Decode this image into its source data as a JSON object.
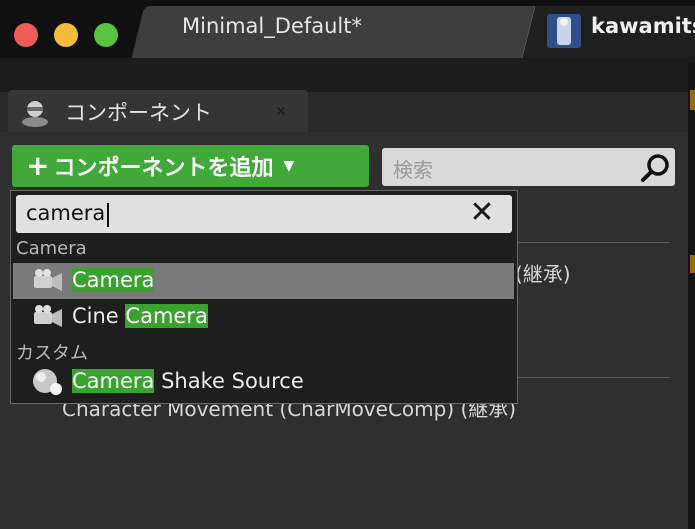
{
  "window": {
    "active_tab": "Minimal_Default*",
    "inactive_tab": "kawamits"
  },
  "panel": {
    "tab_label": "コンポーネント",
    "tab_icon": "component-icon"
  },
  "toolbar": {
    "add_component_label": "コンポーネントを追加",
    "search_placeholder": "検索"
  },
  "background_tree": {
    "inherited_suffix": "(継承)",
    "charmove_row": "Character Movement (CharMoveComp) (継承)"
  },
  "dropdown": {
    "search_value": "camera",
    "categories": [
      {
        "label": "Camera",
        "items": [
          {
            "before": "",
            "match": "Camera",
            "after": "",
            "icon": "camera-icon",
            "selected": true
          },
          {
            "before": "Cine ",
            "match": "Camera",
            "after": "",
            "icon": "camera-icon",
            "selected": false
          }
        ]
      },
      {
        "label": "カスタム",
        "items": [
          {
            "before": "",
            "match": "Camera",
            "after": " Shake Source",
            "icon": "sphere-icon",
            "selected": false
          }
        ]
      }
    ]
  },
  "colors": {
    "accent_green": "#41a83a",
    "highlight_green": "#3aa22e",
    "selected_row": "#7a7a7a"
  }
}
